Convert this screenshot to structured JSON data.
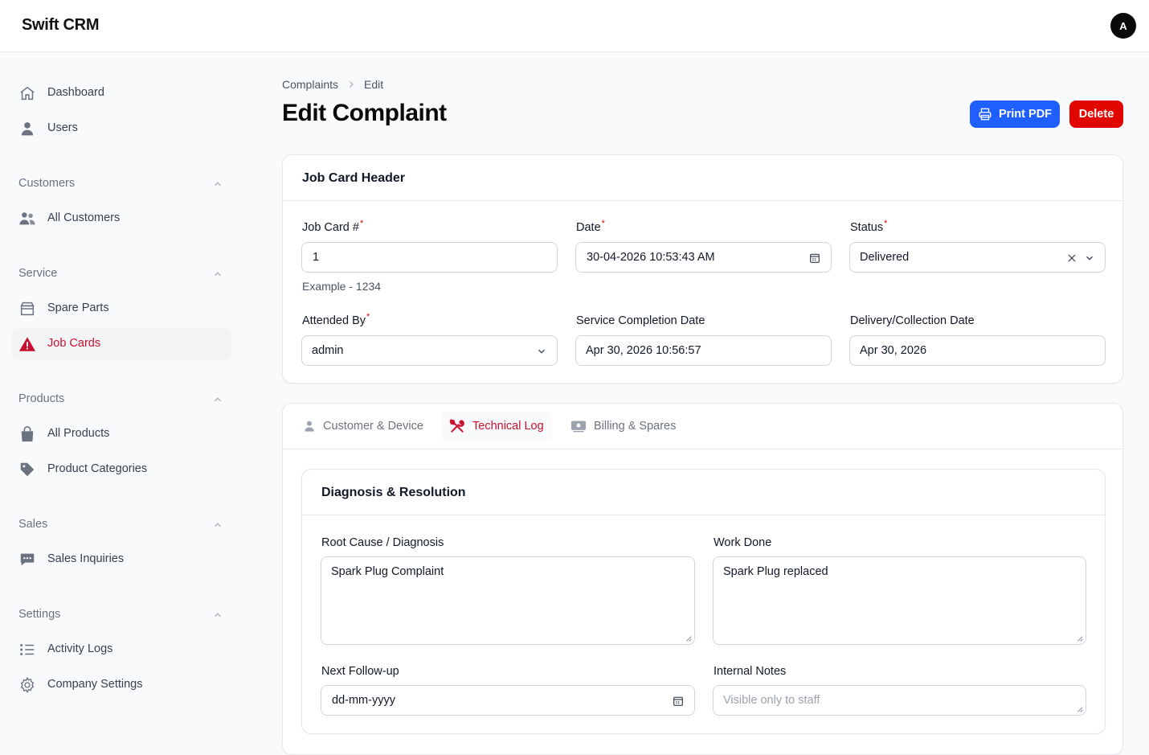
{
  "app": {
    "brand": "Swift CRM",
    "avatar_initial": "A"
  },
  "sidebar": {
    "items_top": [
      {
        "label": "Dashboard",
        "icon": "home-icon"
      },
      {
        "label": "Users",
        "icon": "user-icon"
      }
    ],
    "groups": {
      "customers": {
        "title": "Customers",
        "items": [
          {
            "label": "All Customers",
            "icon": "users-icon"
          }
        ]
      },
      "service": {
        "title": "Service",
        "items": [
          {
            "label": "Spare Parts",
            "icon": "archive-icon"
          },
          {
            "label": "Job Cards",
            "icon": "warning-icon",
            "active": true
          }
        ]
      },
      "products": {
        "title": "Products",
        "items": [
          {
            "label": "All Products",
            "icon": "shopping-bag-icon"
          },
          {
            "label": "Product Categories",
            "icon": "tag-icon"
          }
        ]
      },
      "sales": {
        "title": "Sales",
        "items": [
          {
            "label": "Sales Inquiries",
            "icon": "chat-icon"
          }
        ]
      },
      "settings": {
        "title": "Settings",
        "items": [
          {
            "label": "Activity Logs",
            "icon": "list-icon"
          },
          {
            "label": "Company Settings",
            "icon": "cog-icon"
          }
        ]
      }
    }
  },
  "breadcrumb": {
    "parent": "Complaints",
    "separator": ">",
    "current": "Edit"
  },
  "page": {
    "title": "Edit Complaint"
  },
  "actions": {
    "print": "Print PDF",
    "delete": "Delete"
  },
  "job_card": {
    "title": "Job Card Header",
    "job_card_no": {
      "label": "Job Card #",
      "value": "1",
      "hint": "Example - 1234"
    },
    "date": {
      "label": "Date",
      "value": "30-04-2026 10:53:43 AM"
    },
    "status": {
      "label": "Status",
      "value": "Delivered"
    },
    "attended_by": {
      "label": "Attended By",
      "value": "admin"
    },
    "service_completion": {
      "label": "Service Completion Date",
      "value": "Apr 30, 2026 10:56:57"
    },
    "delivery": {
      "label": "Delivery/Collection Date",
      "value": "Apr 30, 2026"
    },
    "required_mark": "*"
  },
  "tabs": [
    {
      "label": "Customer & Device",
      "icon": "user-icon"
    },
    {
      "label": "Technical Log",
      "icon": "wrench-screwdriver-icon",
      "active": true
    },
    {
      "label": "Billing & Spares",
      "icon": "banknotes-icon"
    }
  ],
  "diagnosis": {
    "title": "Diagnosis & Resolution",
    "root_cause": {
      "label": "Root Cause / Diagnosis",
      "value": "Spark Plug Complaint"
    },
    "work_done": {
      "label": "Work Done",
      "value": "Spark Plug replaced"
    },
    "follow_up": {
      "label": "Next Follow-up",
      "value": "dd-mm-yyyy"
    },
    "internal_notes": {
      "label": "Internal Notes",
      "placeholder": "Visible only to staff"
    }
  },
  "colors": {
    "accent_red": "#c8102e",
    "primary_blue": "#1f5eff",
    "delete_red": "#e10600"
  }
}
